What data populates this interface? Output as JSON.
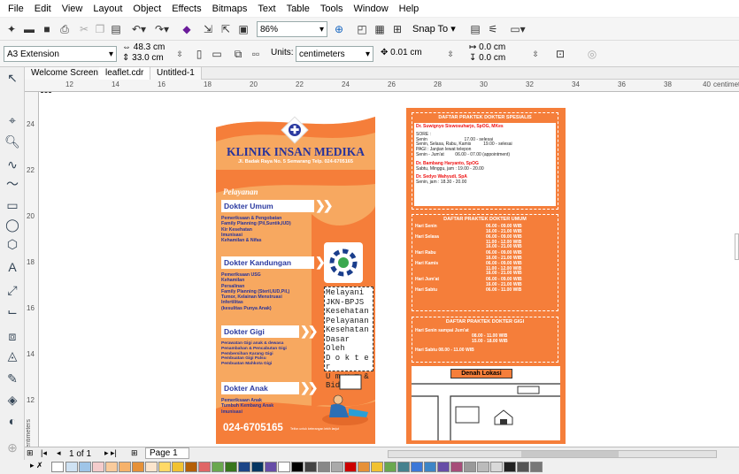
{
  "menu": [
    "File",
    "Edit",
    "View",
    "Layout",
    "Object",
    "Effects",
    "Bitmaps",
    "Text",
    "Table",
    "Tools",
    "Window",
    "Help"
  ],
  "toolbar": {
    "zoom": "86%",
    "snap": "Snap To"
  },
  "property_bar": {
    "page_size": "A3 Extension",
    "width": "48.3 cm",
    "height": "33.0 cm",
    "units_label": "Units:",
    "units": "centimeters",
    "nudge": "0.01 cm",
    "dup_x": "0.0 cm",
    "dup_y": "0.0 cm"
  },
  "tabs": [
    "Welcome Screen",
    "leaflet.cdr",
    "Untitled-1"
  ],
  "hruler": {
    "ticks": [
      "12",
      "14",
      "16",
      "18",
      "20",
      "22",
      "24",
      "26",
      "28",
      "30",
      "32",
      "34",
      "36",
      "38",
      "40"
    ],
    "unit": "centimeters"
  },
  "vruler": {
    "ticks": [
      "24",
      "22",
      "20",
      "18",
      "16",
      "14",
      "12"
    ],
    "unit": "centimeters"
  },
  "pager": {
    "count": "1 of 1",
    "page": "Page 1"
  },
  "leaflet": {
    "title": "KLINIK INSAN MEDIKA",
    "address": "Jl. Badak Raya No. 5 Semarang Telp. 024-6705165",
    "pelayanan": "Pelayanan",
    "sections": [
      {
        "label": "Dokter Umum",
        "items": [
          "Pemeriksaan & Pengobatan",
          "Family Planning (Pil,Suntik,IUD)",
          "Kir Kesehatan",
          "Imunisasi",
          "Kehamilan & Nifas"
        ]
      },
      {
        "label": "Dokter Kandungan",
        "items": [
          "Pemeriksaan USG",
          "Kehamilan",
          "Persalinan",
          "Family Planning (Steril,IUD,Pil,)",
          "Tumor, Kelainan Menstruasi",
          "Infertilitas",
          "(kesulitas Punya Anak)"
        ]
      },
      {
        "label": "Dokter Gigi",
        "items": [
          "Perawatan Gigi anak & dewasa",
          "Penambahan & Pencabutan Gigi",
          "Pembersihan Karang Gigi",
          "Pembuatan Gigi Palsu",
          "Pembuatan Mahkota Gigi"
        ]
      },
      {
        "label": "Dokter Anak",
        "items": [
          "Pemeriksaan Anak",
          "Tumbuh Kembang Anak",
          "Imunisasi"
        ]
      }
    ],
    "bpjs": [
      "Melayani",
      "JKN-BPJS",
      "Kesehatan",
      "Pelayanan",
      "Kesehatan",
      "Dasar Oleh",
      "D o k t e r",
      "U m u m &",
      "Bidan"
    ],
    "phone": "024-6705165",
    "phone_note": "Telfon untuk keterangan lebih lanjut",
    "spec_title": "DAFTAR PRAKTEK DOKTER SPESIALIS",
    "spec": [
      {
        "doctor": "Dr. Suwignyo Siswosuharjo, SpOG, MKes",
        "lines": [
          "SORE :",
          "Senin                              17.00 - selesai",
          "Senin, Selasa, Rabu, Kamis          19.00 - selesai",
          "PAGI : Janjian lewat telepon",
          "Senin - Jum'at         06.00 - 07.00 (appointment)"
        ]
      },
      {
        "doctor": "Dr. Bambang Haryanto, SpOG",
        "lines": [
          "Sabtu, Minggu, jam : 19.00 - 20.00"
        ]
      },
      {
        "doctor": "Dr. Sedyo Wahyudi, SpA",
        "lines": [
          "Senin, jam : 18.30 - 20.00"
        ]
      }
    ],
    "umum_title": "DAFTAR PRAKTEK DOKTER UMUM",
    "umum": [
      {
        "day": "Hari Senin",
        "times": [
          "06.00 - 09.00 WIB",
          "16.00 - 21.00 WIB"
        ]
      },
      {
        "day": "Hari Selasa",
        "times": [
          "06.00 - 09.00 WIB",
          "11.00 - 12.00 WIB",
          "16.00 - 21.00 WIB"
        ]
      },
      {
        "day": "Hari Rabu",
        "times": [
          "06.00 - 09.00 WIB",
          "16.00 - 21.00 WIB"
        ]
      },
      {
        "day": "Hari Kamis",
        "times": [
          "06.00 - 09.00 WIB",
          "11.00 - 12.00 WIB",
          "16.00 - 21.00 WIB"
        ]
      },
      {
        "day": "Hari Jum'at",
        "times": [
          "06.00 - 09.00 WIB",
          "16.00 - 21.00 WIB"
        ]
      },
      {
        "day": "Hari Sabtu",
        "times": [
          "06.00 - 11.00 WIB"
        ]
      }
    ],
    "gigi_title": "DAFTAR PRAKTEK DOKTER GIGI",
    "gigi": [
      "Hari Senin sampai Jum'at",
      "08.00 - 11.00 WIB",
      "15.00 - 18.00 WIB",
      "Hari Sabtu 08.00 - 11.00 WIB"
    ],
    "denah": "Denah Lokasi"
  },
  "colors": {
    "orange": "#f7a860",
    "dark_orange": "#f57e3a",
    "navy": "#28339b"
  }
}
